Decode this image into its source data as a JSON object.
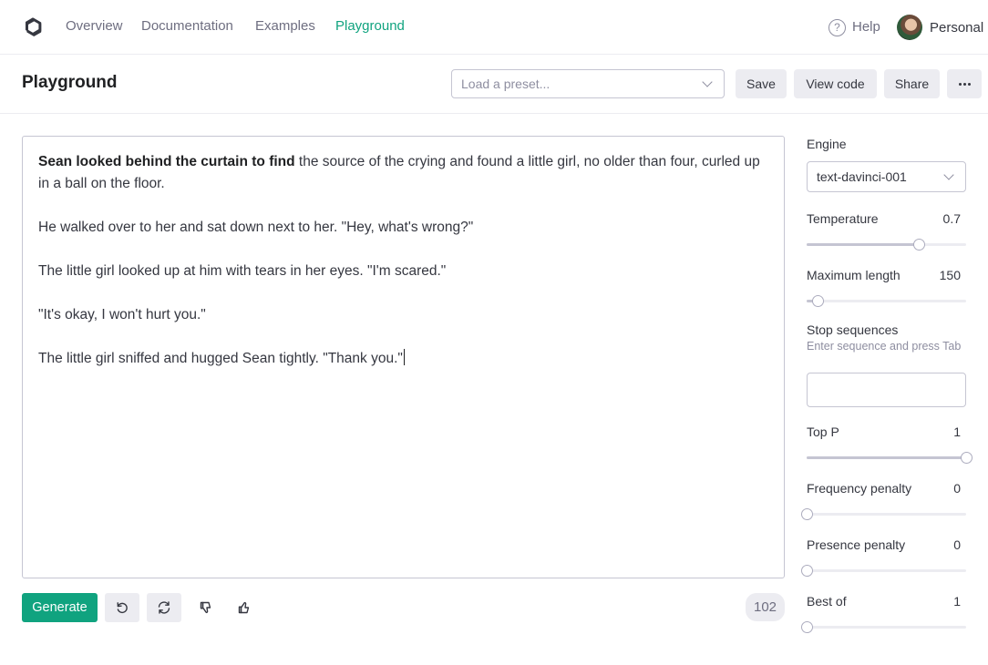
{
  "nav": {
    "links": [
      "Overview",
      "Documentation",
      "Examples",
      "Playground"
    ],
    "active": "Playground",
    "help_label": "Help",
    "help_glyph": "?",
    "account_label": "Personal"
  },
  "header": {
    "title": "Playground",
    "preset_placeholder": "Load a preset...",
    "save_label": "Save",
    "view_code_label": "View code",
    "share_label": "Share"
  },
  "editor": {
    "prompt_bold": "Sean looked behind the curtain to find",
    "paragraph_1_rest": " the source of the crying and found a little girl, no older than four, curled up in a ball on the floor.",
    "paragraph_2": "He walked over to her and sat down next to her. \"Hey, what's wrong?\"",
    "paragraph_3": "The little girl looked up at him with tears in her eyes. \"I'm scared.\"",
    "paragraph_4": "\"It's okay, I won't hurt you.\"",
    "paragraph_5": "The little girl sniffed and hugged Sean tightly. \"Thank you.\""
  },
  "actions": {
    "generate_label": "Generate",
    "token_count": "102"
  },
  "settings": {
    "engine_label": "Engine",
    "engine_value": "text-davinci-001",
    "temperature_label": "Temperature",
    "temperature_value": "0.7",
    "temperature_fraction": 0.7,
    "max_length_label": "Maximum length",
    "max_length_value": "150",
    "max_length_fraction": 0.07,
    "stop_label": "Stop sequences",
    "stop_hint": "Enter sequence and press Tab",
    "top_p_label": "Top P",
    "top_p_value": "1",
    "top_p_fraction": 1,
    "freq_label": "Frequency penalty",
    "freq_value": "0",
    "freq_fraction": 0,
    "presence_label": "Presence penalty",
    "presence_value": "0",
    "presence_fraction": 0,
    "best_of_label": "Best of",
    "best_of_value": "1",
    "best_of_fraction": 0
  },
  "colors": {
    "accent": "#10a37f",
    "button_bg": "#ececf1",
    "border": "#c5c5d2"
  }
}
